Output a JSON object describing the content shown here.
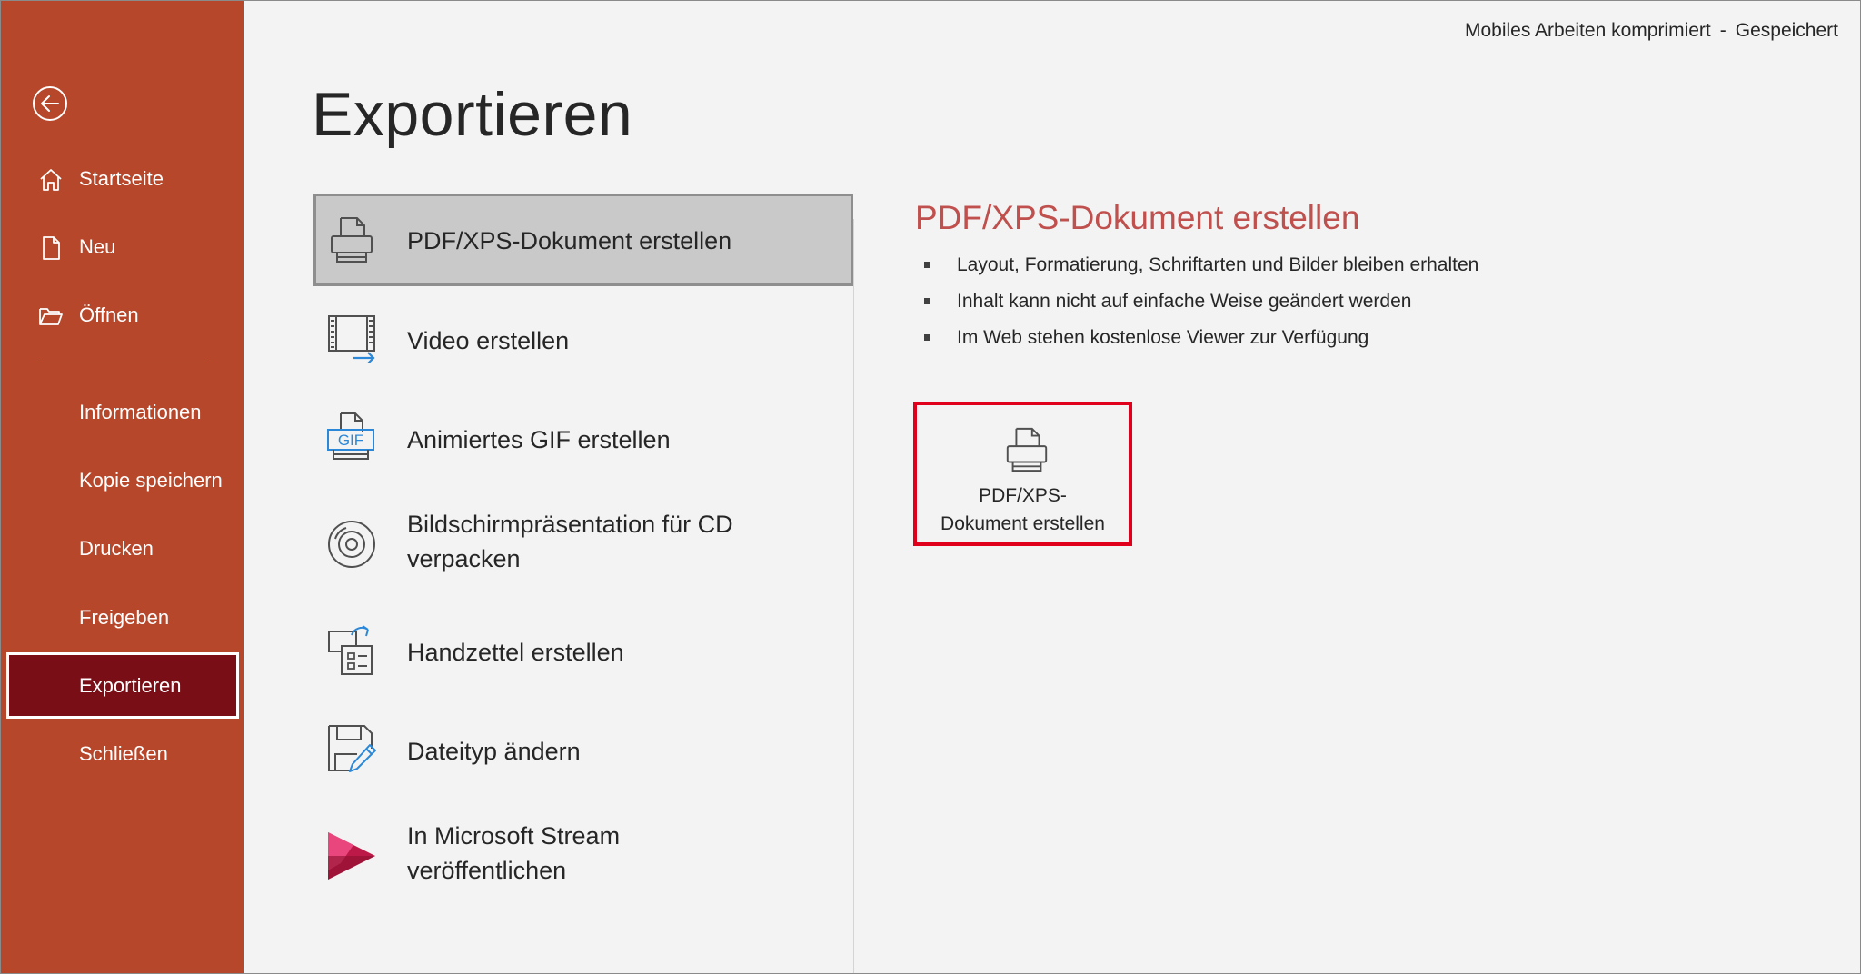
{
  "header": {
    "document_name": "Mobiles Arbeiten komprimiert",
    "separator": "-",
    "save_state": "Gespeichert"
  },
  "sidebar": {
    "back_icon": "back-arrow-circle-icon",
    "items": [
      {
        "label": "Startseite",
        "icon": "home-icon"
      },
      {
        "label": "Neu",
        "icon": "new-document-icon"
      },
      {
        "label": "Öffnen",
        "icon": "folder-open-icon"
      },
      {
        "label": "Informationen"
      },
      {
        "label": "Kopie speichern"
      },
      {
        "label": "Drucken"
      },
      {
        "label": "Freigeben"
      },
      {
        "label": "Exportieren",
        "selected": true
      },
      {
        "label": "Schließen"
      }
    ]
  },
  "main": {
    "title": "Exportieren",
    "export_options": [
      {
        "label": "PDF/XPS-Dokument erstellen",
        "icon": "pdf-xps-icon",
        "selected": true
      },
      {
        "label": "Video erstellen",
        "icon": "video-icon"
      },
      {
        "label": "Animiertes GIF erstellen",
        "icon": "gif-icon",
        "icon_text": "GIF"
      },
      {
        "label_line1": "Bildschirmpräsentation für CD",
        "label_line2": "verpacken",
        "icon": "cd-icon"
      },
      {
        "label": "Handzettel erstellen",
        "icon": "handout-icon"
      },
      {
        "label": "Dateityp ändern",
        "icon": "change-filetype-icon"
      },
      {
        "label_line1": "In Microsoft Stream",
        "label_line2": "veröffentlichen",
        "icon": "stream-icon"
      }
    ],
    "detail": {
      "title": "PDF/XPS-Dokument erstellen",
      "bullets": [
        "Layout, Formatierung, Schriftarten und Bilder bleiben erhalten",
        "Inhalt kann nicht auf einfache Weise geändert werden",
        "Im Web stehen kostenlose Viewer zur Verfügung"
      ],
      "button_line1": "PDF/XPS-",
      "button_line2": "Dokument erstellen"
    }
  },
  "colors": {
    "sidebar_bg": "#b7472a",
    "sidebar_selected": "#7a0e16",
    "accent_title": "#c0504d",
    "highlight_border": "#e0001b"
  }
}
